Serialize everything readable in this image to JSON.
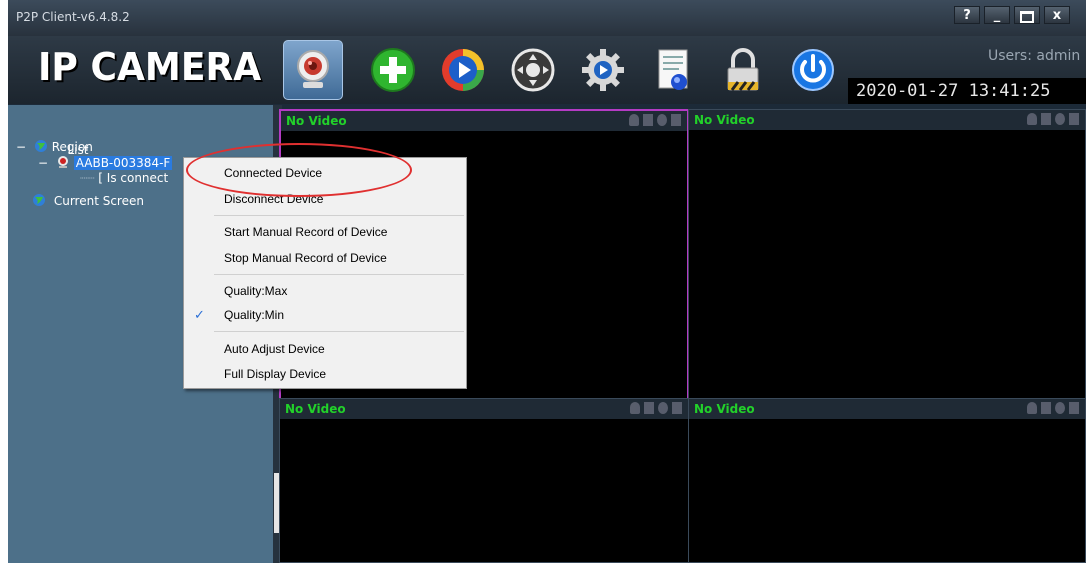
{
  "window": {
    "title": "P2P Client-v6.4.8.2",
    "controls": [
      "?",
      "_",
      "□",
      "x"
    ]
  },
  "toolbar": {
    "logo": "IP CAMERA",
    "tools": [
      {
        "icon": "webcam-icon",
        "active": true
      },
      {
        "icon": "add-icon"
      },
      {
        "icon": "playback-icon"
      },
      {
        "icon": "ptz-icon"
      },
      {
        "icon": "settings-icon"
      },
      {
        "icon": "log-icon"
      },
      {
        "icon": "lock-icon"
      },
      {
        "icon": "power-icon"
      }
    ],
    "users": "Users: admin",
    "datetime": "2020-01-27 13:41:25"
  },
  "left_panel": {
    "tab": "List",
    "tree": [
      {
        "label": "Region",
        "expander": "−"
      },
      {
        "label": "AABB-003384-F",
        "expander": "−",
        "selected": true
      },
      {
        "label": "[ Is connect"
      },
      {
        "label": "Current Screen"
      }
    ]
  },
  "video": {
    "panes": [
      "No Video",
      "No Video",
      "No Video",
      "No Video"
    ],
    "active_pane": 0
  },
  "context_menu": {
    "items": [
      {
        "label": "Connected Device"
      },
      {
        "label": "Disconnect Device"
      },
      {
        "label": "Start Manual Record of Device"
      },
      {
        "label": "Stop Manual Record of Device"
      },
      {
        "label": "Quality:Max"
      },
      {
        "label": "Quality:Min",
        "checked": true
      },
      {
        "label": "Auto Adjust Device"
      },
      {
        "label": "Full Display Device"
      }
    ],
    "check_mark": "✓"
  },
  "colors": {
    "no_video": "#22d12a",
    "active_border": "#b43bc4",
    "annotation": "#e03030",
    "selection": "#2a7be0"
  }
}
